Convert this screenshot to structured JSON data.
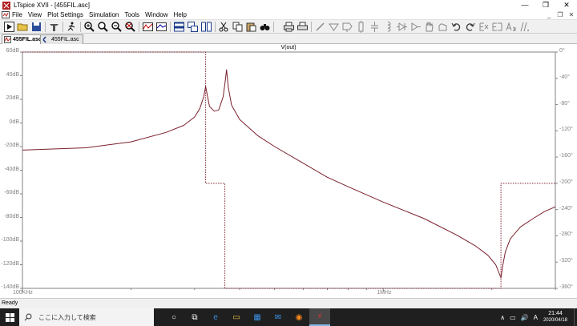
{
  "window": {
    "title": "LTspice XVII - [455FIL.asc]",
    "controls": [
      "—",
      "❐",
      "✕"
    ]
  },
  "menu": {
    "items": [
      "File",
      "View",
      "Plot Settings",
      "Simulation",
      "Tools",
      "Window",
      "Help"
    ],
    "mdi_controls": [
      "_",
      "❐",
      "✕"
    ]
  },
  "tabs": [
    {
      "label": "455FIL.asc",
      "icon": "waveform-icon",
      "active": true
    },
    {
      "label": "455FIL.asc",
      "icon": "schematic-icon",
      "active": false
    }
  ],
  "chart_data": {
    "type": "line",
    "title": "V(out)",
    "x_scale": "log",
    "xlim": [
      100000,
      3000000
    ],
    "x_ticks": [
      {
        "value": 100000,
        "label": "100KHz"
      },
      {
        "value": 1000000,
        "label": "1MHz"
      }
    ],
    "y_left": {
      "label_ticks": [
        "60dB",
        "40dB",
        "20dB",
        "0dB",
        "-20dB",
        "-40dB",
        "-60dB",
        "-80dB",
        "-100dB",
        "-120dB",
        "-140dB"
      ],
      "ylim": [
        -140,
        60
      ]
    },
    "y_right": {
      "label_ticks": [
        "0°",
        "-40°",
        "-80°",
        "-120°",
        "-160°",
        "-200°",
        "-240°",
        "-280°",
        "-320°",
        "-360°"
      ],
      "ylim": [
        -360,
        0
      ]
    },
    "series": [
      {
        "color": "#7a1f2b",
        "style": "solid",
        "x": [
          100000,
          150000,
          200000,
          250000,
          280000,
          300000,
          310000,
          318000,
          322000,
          326000,
          330000,
          340000,
          350000,
          360000,
          364000,
          368000,
          372000,
          380000,
          400000,
          450000,
          500000,
          600000,
          700000,
          800000,
          1000000,
          1300000,
          1600000,
          1800000,
          1950000,
          2050000,
          2100000,
          2120000,
          2140000,
          2180000,
          2250000,
          2400000,
          2600000,
          2800000,
          3000000
        ],
        "y": [
          -23,
          -21,
          -16,
          -8,
          -2,
          5,
          12,
          22,
          31,
          22,
          14,
          10,
          11,
          22,
          33,
          45,
          30,
          15,
          3,
          -11,
          -20,
          -34,
          -46,
          -54,
          -67,
          -81,
          -95,
          -104,
          -112,
          -120,
          -128,
          -131,
          -122,
          -109,
          -98,
          -88,
          -81,
          -75,
          -71
        ]
      },
      {
        "color": "#7a1f2b",
        "style": "dotted",
        "axis": "right",
        "x": [
          100000,
          322000,
          322000,
          364000,
          364000,
          2120000,
          2120000,
          3000000
        ],
        "y": [
          0,
          0,
          -200,
          -200,
          -360,
          -360,
          -200,
          -200
        ]
      }
    ]
  },
  "status": {
    "text": "Ready"
  },
  "taskbar": {
    "search_placeholder": "ここに入力して検索",
    "apps": [
      {
        "name": "cortana-icon",
        "glyph": "○"
      },
      {
        "name": "task-view-icon",
        "glyph": "⧉"
      },
      {
        "name": "edge-icon",
        "glyph": "e"
      },
      {
        "name": "explorer-icon",
        "glyph": "▭"
      },
      {
        "name": "store-icon",
        "glyph": "▦"
      },
      {
        "name": "mail-icon",
        "glyph": "✉"
      },
      {
        "name": "firefox-icon",
        "glyph": "◉"
      },
      {
        "name": "ltspice-icon",
        "glyph": "⚡"
      }
    ],
    "tray": [
      "∧",
      "▭",
      "🔊",
      "A"
    ],
    "time": "21:44",
    "date": "2020/04/18"
  }
}
